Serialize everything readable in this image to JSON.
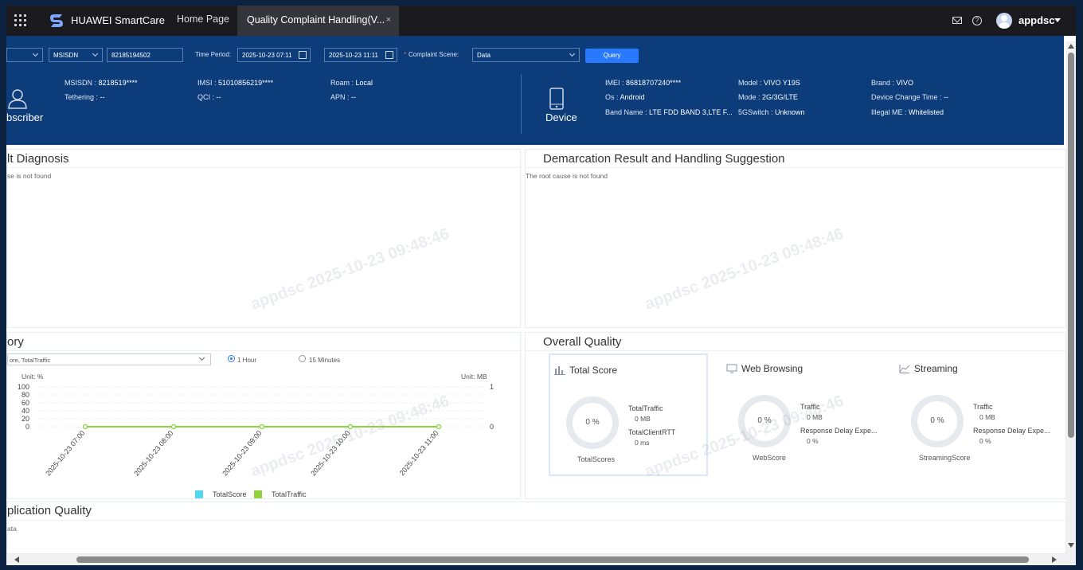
{
  "header": {
    "brand": "HUAWEI SmartCare",
    "tabs": [
      {
        "label": "Home Page"
      },
      {
        "label": "Quality Complaint Handling(V..."
      }
    ],
    "close_symbol": "×",
    "username": "appdsc",
    "help_symbol": "?"
  },
  "query": {
    "id_type": "MSISDN",
    "msisdn_value": "82185194502",
    "time_period_label": "Time Period:",
    "start_time": "2025-10-23 07:11",
    "end_time": "2025-10-23 11:11",
    "complaint_scene_label": "Complaint Scene:",
    "complaint_scene_required": "*",
    "complaint_scene": "Data",
    "query_button": "Query"
  },
  "subscriber": {
    "section_label": "bscriber",
    "fields": [
      {
        "key": "MSISDN",
        "value": "8218519****"
      },
      {
        "key": "IMSI",
        "value": "51010856219****"
      },
      {
        "key": "Roam",
        "value": "Local"
      },
      {
        "key": "Tethering",
        "value": "--"
      },
      {
        "key": "QCI",
        "value": "--"
      },
      {
        "key": "APN",
        "value": "--"
      }
    ]
  },
  "device": {
    "section_label": "Device",
    "fields": [
      {
        "key": "IMEI",
        "value": "86818707240****"
      },
      {
        "key": "Model",
        "value": "VIVO Y19S"
      },
      {
        "key": "Brand",
        "value": "VIVO"
      },
      {
        "key": "Os",
        "value": "Android"
      },
      {
        "key": "Mode",
        "value": "2G/3G/LTE"
      },
      {
        "key": "Device Change Time",
        "value": "--"
      },
      {
        "key": "Band Name",
        "value": "LTE FDD BAND 3,LTE F..."
      },
      {
        "key": "5GSwitch",
        "value": "Unknown"
      },
      {
        "key": "Illegal ME",
        "value": "Whitelisted"
      }
    ]
  },
  "fault_diagnosis": {
    "title": "lt Diagnosis",
    "message": "se is not found"
  },
  "demarcation": {
    "title": "Demarcation Result and Handling Suggestion",
    "message": "The root cause is not found"
  },
  "history": {
    "title": "ory",
    "metric_select": "ore, TotalTraffic",
    "granularity": [
      {
        "label": "1 Hour",
        "selected": true
      },
      {
        "label": "15 Minutes",
        "selected": false
      }
    ],
    "unit_left": "Unit: %",
    "unit_right": "Unit: MB"
  },
  "chart_data": {
    "type": "line",
    "x": [
      "2025-10-23 07:00",
      "2025-10-23 08:00",
      "2025-10-23 09:00",
      "2025-10-23 10:00",
      "2025-10-23 11:00"
    ],
    "y_left_ticks": [
      "100",
      "80",
      "60",
      "40",
      "20",
      "0"
    ],
    "y_right_ticks": [
      "1",
      "0"
    ],
    "ylim_left": [
      0,
      100
    ],
    "ylim_right": [
      0,
      1
    ],
    "series": [
      {
        "name": "TotalScore",
        "values": [
          0,
          0,
          0,
          0,
          0
        ],
        "color": "#4fd8f0"
      },
      {
        "name": "TotalTraffic",
        "values": [
          0,
          0,
          0,
          0,
          0
        ],
        "color": "#8ed33b"
      }
    ],
    "legend": "bottom"
  },
  "overall_quality": {
    "title": "Overall Quality",
    "cards": [
      {
        "title": "Total Score",
        "score": "0 %",
        "score_label": "TotalScores",
        "metrics": [
          {
            "name": "TotalTraffic",
            "value": "0 MB"
          },
          {
            "name": "TotalClientRTT",
            "value": "0 ms"
          }
        ]
      },
      {
        "title": "Web Browsing",
        "score": "0 %",
        "score_label": "WebScore",
        "metrics": [
          {
            "name": "Traffic",
            "value": "0 MB"
          },
          {
            "name": "Response Delay Expe...",
            "value": "0 %"
          }
        ]
      },
      {
        "title": "Streaming",
        "score": "0 %",
        "score_label": "StreamingScore",
        "metrics": [
          {
            "name": "Traffic",
            "value": "0 MB"
          },
          {
            "name": "Response Delay Expe...",
            "value": "0 %"
          }
        ]
      }
    ]
  },
  "application_quality": {
    "title": "plication Quality",
    "message": "ata"
  },
  "watermark": "appdsc 2025-10-23 09:48:46",
  "colors": {
    "topbar": "#1b1b1f",
    "banner": "#0c3d7a",
    "accent": "#2979ff"
  }
}
